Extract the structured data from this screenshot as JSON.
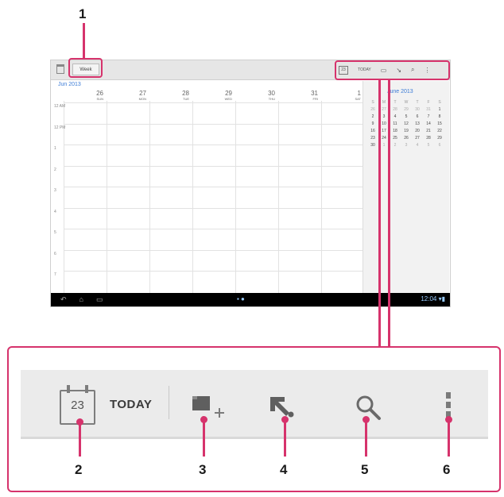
{
  "callouts": [
    "1",
    "2",
    "3",
    "4",
    "5",
    "6"
  ],
  "tablet": {
    "view_label": "Week",
    "month_label": "Jun 2013",
    "days": [
      {
        "date": "26",
        "weekday": "SUN"
      },
      {
        "date": "27",
        "weekday": "MON"
      },
      {
        "date": "28",
        "weekday": "TUE"
      },
      {
        "date": "29",
        "weekday": "WED"
      },
      {
        "date": "30",
        "weekday": "THU"
      },
      {
        "date": "31",
        "weekday": "FRI"
      },
      {
        "date": "1",
        "weekday": "SAT"
      }
    ],
    "time_labels": [
      "12 AM",
      "12 PM",
      "1",
      "2",
      "3",
      "4",
      "5",
      "6",
      "7"
    ],
    "mini_today": "TODAY",
    "side_title": "June 2013",
    "mini_weekdays": [
      "S",
      "M",
      "T",
      "W",
      "T",
      "F",
      "S"
    ],
    "mini_days": [
      "26",
      "27",
      "28",
      "29",
      "30",
      "31",
      "1",
      "2",
      "3",
      "4",
      "5",
      "6",
      "7",
      "8",
      "9",
      "10",
      "11",
      "12",
      "13",
      "14",
      "15",
      "16",
      "17",
      "18",
      "19",
      "20",
      "21",
      "22",
      "23",
      "24",
      "25",
      "26",
      "27",
      "28",
      "29",
      "30",
      "1",
      "2",
      "3",
      "4",
      "5",
      "6"
    ],
    "clock": "12:04"
  },
  "actionbar": {
    "calendar_day": "23",
    "today_label": "TODAY",
    "icons": [
      "calendar-today-icon",
      "new-event-icon",
      "sync-icon",
      "search-icon",
      "overflow-menu-icon"
    ]
  },
  "colors": {
    "callout": "#d6336c",
    "accent": "#3b7bd6"
  }
}
